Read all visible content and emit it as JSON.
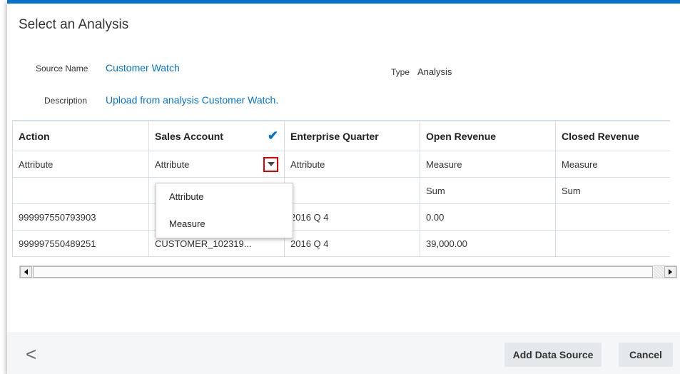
{
  "dialog": {
    "title": "Select an Analysis",
    "source_name_label": "Source Name",
    "source_name_value": "Customer Watch",
    "type_label": "Type",
    "type_value": "Analysis",
    "description_label": "Description",
    "description_value": "Upload from analysis Customer Watch."
  },
  "grid": {
    "headers": [
      "Action",
      "Sales Account",
      "Enterprise Quarter",
      "Open Revenue",
      "Closed Revenue"
    ],
    "type_row": [
      "Attribute",
      "Attribute",
      "Attribute",
      "Measure",
      "Measure"
    ],
    "agg_row": [
      "",
      "",
      "",
      "Sum",
      "Sum"
    ],
    "rows": [
      [
        "999997550793903",
        "",
        "2016 Q 4",
        "0.00",
        ""
      ],
      [
        "999997550489251",
        "CUSTOMER_102319...",
        "2016 Q 4",
        "39,000.00",
        ""
      ]
    ]
  },
  "dropdown": {
    "options": [
      "Attribute",
      "Measure"
    ]
  },
  "footer": {
    "back_icon": "<",
    "add_label": "Add Data Source",
    "cancel_label": "Cancel"
  },
  "colors": {
    "accent": "#0572ce",
    "highlight": "#e00000"
  }
}
